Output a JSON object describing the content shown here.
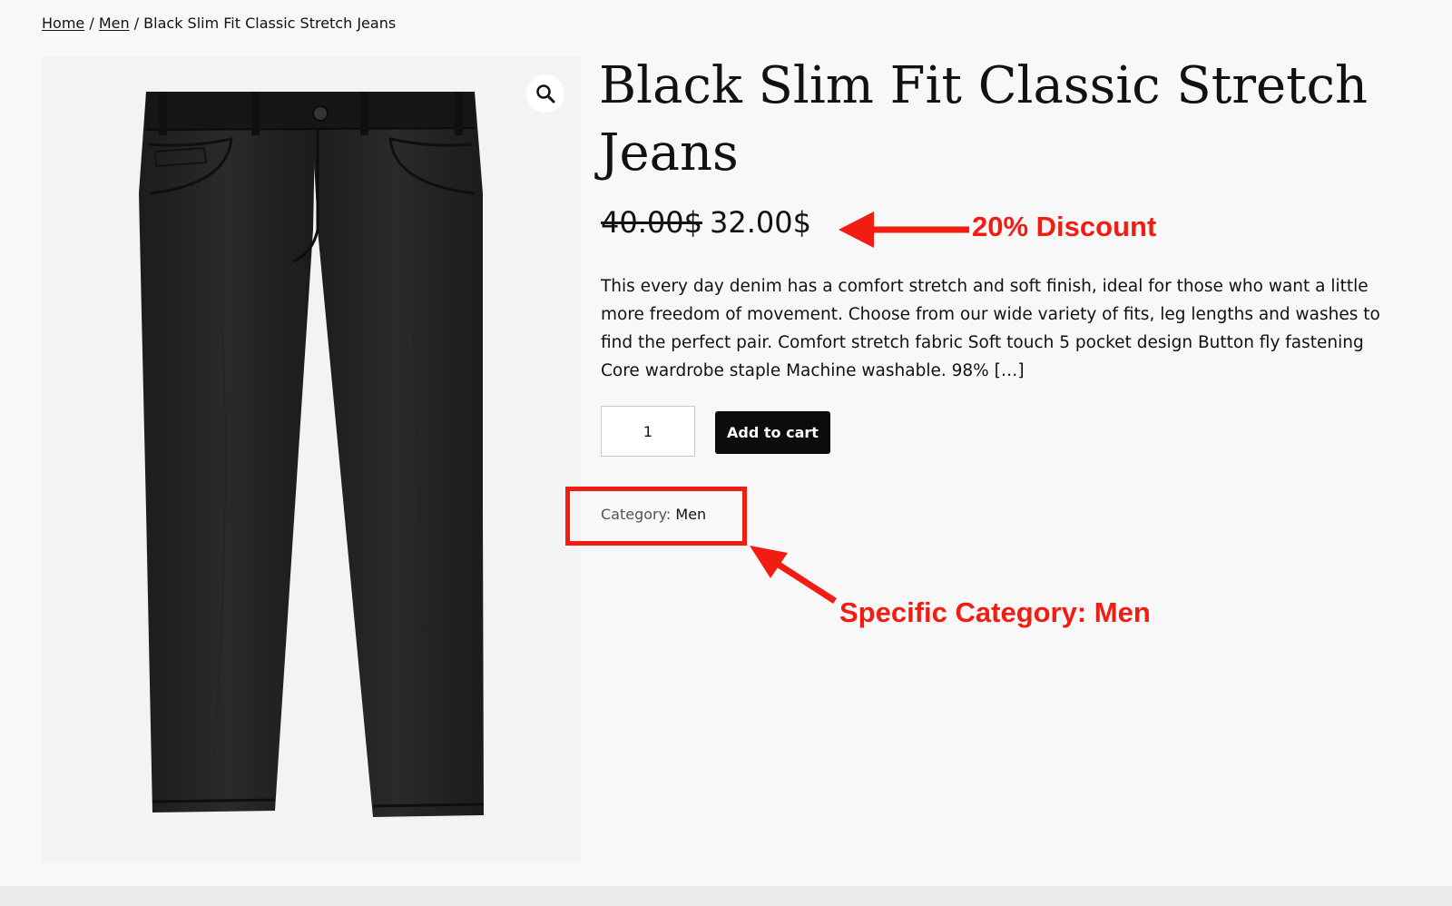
{
  "breadcrumb": {
    "home": "Home",
    "separator": " / ",
    "category": "Men",
    "current": "Black Slim Fit Classic Stretch Jeans"
  },
  "product": {
    "title": "Black Slim Fit Classic Stretch Jeans",
    "old_price": "40.00$",
    "price": "32.00$",
    "description": "This every day denim has a comfort stretch and soft finish, ideal for those who want a little more freedom of movement. Choose from our wide variety of fits, leg lengths and washes to find the perfect pair. Comfort stretch fabric Soft touch 5 pocket design Button fly fastening Core wardrobe staple Machine washable. 98% […]",
    "quantity": "1",
    "add_to_cart_label": "Add to cart",
    "category_label": "Category:",
    "category_value": "Men"
  },
  "annotations": {
    "discount": "20% Discount",
    "category": "Specific Category: Men",
    "color": "#f21d12"
  },
  "icons": {
    "zoom": "magnifier-icon"
  },
  "colors": {
    "button_bg": "#0c0c0c",
    "page_bg": "#f8f8f8"
  }
}
